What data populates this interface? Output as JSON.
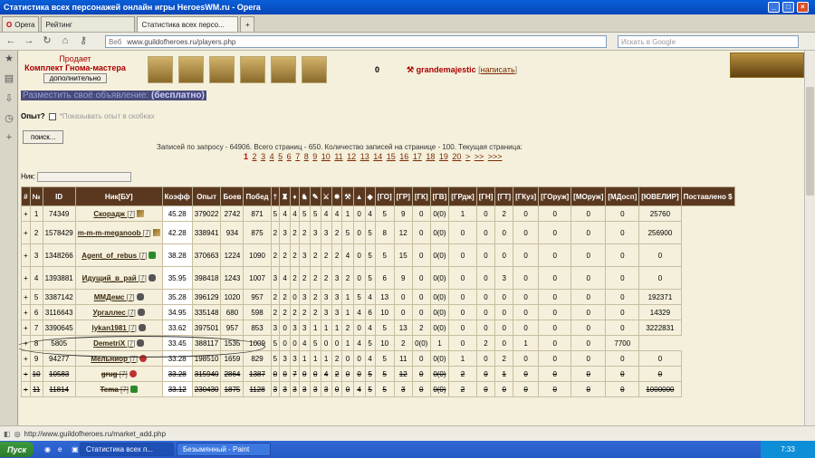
{
  "window": {
    "title": "Статистика всех персонажей онлайн игры HeroesWM.ru - Opera"
  },
  "tabs": [
    {
      "label": "Opera"
    },
    {
      "label": "Рейтинг"
    },
    {
      "label": "Статистика всех персо..."
    }
  ],
  "nav": {
    "address_prefix": "Веб",
    "address": "www.guildofheroes.ru/players.php",
    "search_placeholder": "Искать в Google"
  },
  "ad": {
    "status": "Продает",
    "name": "Комплект Гнома-мастера",
    "more": "дополнительно",
    "qty": "0",
    "seller": "grandemajestic",
    "write_open": "[",
    "write": "написать",
    "write_close": "]"
  },
  "place_ad": "Разместить своё объявление:",
  "place_ad_free": "(бесплатно)",
  "exp_label": "Опыт?",
  "exp_hint": "*Показывать опыт в скобках",
  "search_button": "поиск...",
  "summary": "Записей по запросу - 64906. Всего страниц - 650. Количество записей на странице - 100. Текущая страница:",
  "pages": [
    "1",
    "2",
    "3",
    "4",
    "5",
    "6",
    "7",
    "8",
    "9",
    "10",
    "11",
    "12",
    "13",
    "14",
    "15",
    "16",
    "17",
    "18",
    "19",
    "20",
    ">",
    ">>",
    ">>>"
  ],
  "nick_label": "Ник:",
  "table": {
    "headers": [
      "#",
      "№",
      "ID",
      "Ник[БУ]",
      "Коэфф",
      "Опыт",
      "Боев",
      "Побед",
      "",
      "",
      "",
      "",
      "",
      "",
      "",
      "",
      "",
      "",
      "[ГО]",
      "[ГР]",
      "[ГК]",
      "[ГВ]",
      "[ГРдж]",
      "[ГН]",
      "[ГТ]",
      "[ГКуз]",
      "[ГОруж]",
      "[МОруж]",
      "[МДосп]",
      "[ЮВЕЛИР]",
      "Поставлено $"
    ],
    "rows": [
      [
        "+",
        "1",
        "74349",
        "Скорадж",
        "[7]",
        "45.28",
        "379022",
        "2742",
        "871",
        "5",
        "4",
        "4",
        "5",
        "5",
        "4",
        "4",
        "1",
        "0",
        "4",
        "5",
        "9",
        "0",
        "0(0)",
        "1",
        "0",
        "2",
        "0",
        "0",
        "0",
        "0",
        "25760"
      ],
      [
        "+",
        "2",
        "1578429",
        "m-m-m-meganoob",
        "[7]",
        "42.28",
        "338941",
        "934",
        "875",
        "2",
        "3",
        "2",
        "2",
        "3",
        "3",
        "2",
        "5",
        "0",
        "5",
        "8",
        "12",
        "0",
        "0(0)",
        "0",
        "0",
        "0",
        "0",
        "0",
        "0",
        "0",
        "256900"
      ],
      [
        "+",
        "3",
        "1348266",
        "Agent_of_rebus",
        "[7]",
        "38.28",
        "370663",
        "1224",
        "1090",
        "2",
        "2",
        "2",
        "3",
        "2",
        "2",
        "2",
        "4",
        "0",
        "5",
        "5",
        "15",
        "0",
        "0(0)",
        "0",
        "0",
        "0",
        "0",
        "0",
        "0",
        "0",
        "0"
      ],
      [
        "+",
        "4",
        "1393881",
        "Идущий_в_рай",
        "[7]",
        "35.95",
        "398418",
        "1243",
        "1007",
        "3",
        "4",
        "2",
        "2",
        "2",
        "2",
        "3",
        "2",
        "0",
        "5",
        "6",
        "9",
        "0",
        "0(0)",
        "0",
        "0",
        "3",
        "0",
        "0",
        "0",
        "0",
        "0"
      ],
      [
        "+",
        "5",
        "3387142",
        "ММДемс",
        "[7]",
        "35.28",
        "396129",
        "1020",
        "957",
        "2",
        "2",
        "0",
        "3",
        "2",
        "3",
        "3",
        "1",
        "5",
        "4",
        "13",
        "0",
        "0",
        "0(0)",
        "0",
        "0",
        "0",
        "0",
        "0",
        "0",
        "0",
        "192371"
      ],
      [
        "+",
        "6",
        "3116643",
        "Ургаллес",
        "[7]",
        "34.95",
        "335148",
        "680",
        "598",
        "2",
        "2",
        "2",
        "2",
        "2",
        "3",
        "3",
        "1",
        "4",
        "6",
        "10",
        "0",
        "0",
        "0(0)",
        "0",
        "0",
        "0",
        "0",
        "0",
        "0",
        "0",
        "14329"
      ],
      [
        "+",
        "7",
        "3390645",
        "lykan1981",
        "[7]",
        "33.62",
        "397501",
        "957",
        "853",
        "3",
        "0",
        "3",
        "3",
        "1",
        "1",
        "1",
        "2",
        "0",
        "4",
        "5",
        "13",
        "2",
        "0(0)",
        "0",
        "0",
        "0",
        "0",
        "0",
        "0",
        "0",
        "3222831"
      ],
      [
        "+",
        "8",
        "5805",
        "DemetriX",
        "[7]",
        "33.45",
        "388117",
        "1535",
        "1009",
        "5",
        "0",
        "0",
        "4",
        "5",
        "0",
        "0",
        "1",
        "4",
        "5",
        "10",
        "2",
        "0(0)",
        "1",
        "0",
        "2",
        "0",
        "1",
        "0",
        "0",
        "7700"
      ],
      [
        "+",
        "9",
        "94277",
        "Мельниор",
        "[7]",
        "33.28",
        "198510",
        "1659",
        "829",
        "5",
        "3",
        "3",
        "1",
        "1",
        "1",
        "2",
        "0",
        "0",
        "4",
        "5",
        "11",
        "0",
        "0(0)",
        "1",
        "0",
        "2",
        "0",
        "0",
        "0",
        "0",
        "0"
      ],
      [
        "+",
        "10",
        "10583",
        "grug",
        "[7]",
        "33.28",
        "315940",
        "2864",
        "1387",
        "0",
        "0",
        "7",
        "0",
        "0",
        "4",
        "2",
        "0",
        "0",
        "5",
        "5",
        "12",
        "0",
        "0(0)",
        "2",
        "0",
        "1",
        "0",
        "0",
        "0",
        "0",
        "0"
      ],
      [
        "+",
        "11",
        "11814",
        "Tema",
        "[7]",
        "33.12",
        "230430",
        "1875",
        "1128",
        "3",
        "3",
        "3",
        "3",
        "3",
        "3",
        "0",
        "0",
        "4",
        "5",
        "5",
        "3",
        "0",
        "0(0)",
        "2",
        "0",
        "0",
        "0",
        "0",
        "0",
        "0",
        "1000000"
      ]
    ]
  },
  "status": {
    "url": "http://www.guildofheroes.ru/market_add.php"
  },
  "taskbar": {
    "start": "Пуск",
    "tasks": [
      "Статистика всех п...",
      "Безымянный - Paint"
    ],
    "clock": "7:33"
  }
}
